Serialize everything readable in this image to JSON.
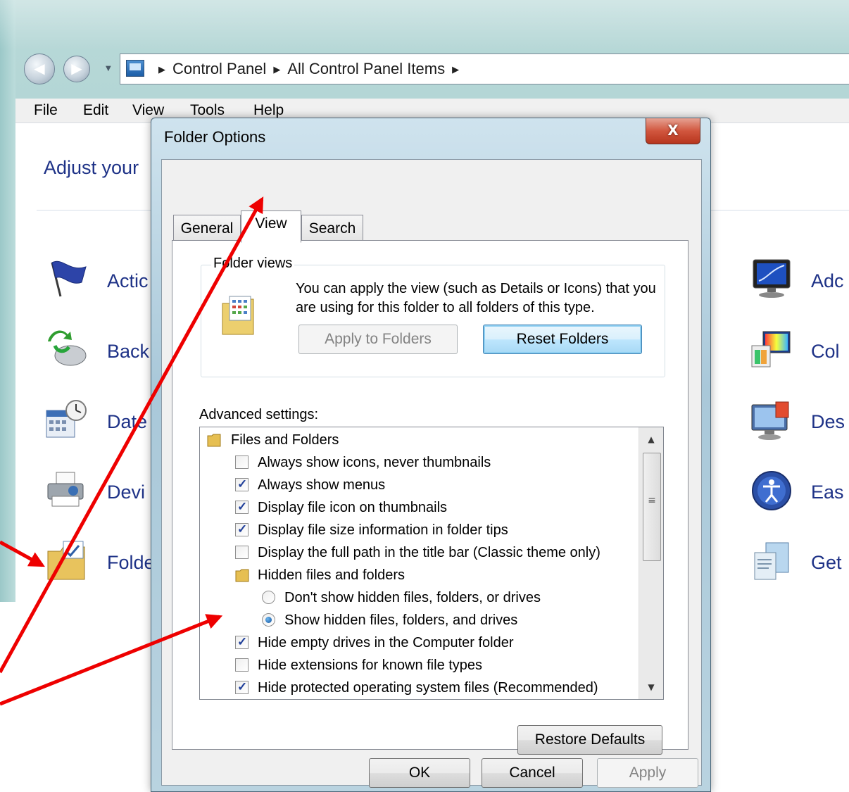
{
  "address_bar": {
    "crumbs": [
      "Control Panel",
      "All Control Panel Items"
    ]
  },
  "menu": [
    "File",
    "Edit",
    "View",
    "Tools",
    "Help"
  ],
  "control_panel": {
    "heading": "Adjust your",
    "items_left": [
      "Actic",
      "Back",
      "Date",
      "Devi",
      "Folde"
    ],
    "items_right": [
      "Adc",
      "Col",
      "Des",
      "Eas",
      "Get"
    ]
  },
  "dialog": {
    "title": "Folder Options",
    "close_label": "X",
    "tabs": [
      "General",
      "View",
      "Search"
    ],
    "folder_views": {
      "label": "Folder views",
      "description": "You can apply the view (such as Details or Icons) that you are using for this folder to all folders of this type.",
      "apply_button": "Apply to Folders",
      "reset_button": "Reset Folders"
    },
    "advanced_label": "Advanced settings:",
    "tree_items": [
      {
        "label": "Files and Folders",
        "type": "folder",
        "level": 0
      },
      {
        "label": "Always show icons, never thumbnails",
        "type": "checkbox",
        "checked": false,
        "level": 1
      },
      {
        "label": "Always show menus",
        "type": "checkbox",
        "checked": true,
        "level": 1
      },
      {
        "label": "Display file icon on thumbnails",
        "type": "checkbox",
        "checked": true,
        "level": 1
      },
      {
        "label": "Display file size information in folder tips",
        "type": "checkbox",
        "checked": true,
        "level": 1
      },
      {
        "label": "Display the full path in the title bar (Classic theme only)",
        "type": "checkbox",
        "checked": false,
        "level": 1
      },
      {
        "label": "Hidden files and folders",
        "type": "folder",
        "level": 1
      },
      {
        "label": "Don't show hidden files, folders, or drives",
        "type": "radio",
        "checked": false,
        "level": 2
      },
      {
        "label": "Show hidden files, folders, and drives",
        "type": "radio",
        "checked": true,
        "level": 2
      },
      {
        "label": "Hide empty drives in the Computer folder",
        "type": "checkbox",
        "checked": true,
        "level": 1
      },
      {
        "label": "Hide extensions for known file types",
        "type": "checkbox",
        "checked": false,
        "level": 1
      },
      {
        "label": "Hide protected operating system files (Recommended)",
        "type": "checkbox",
        "checked": true,
        "level": 1
      }
    ],
    "restore_defaults": "Restore Defaults",
    "ok": "OK",
    "cancel": "Cancel",
    "apply": "Apply"
  },
  "colors": {
    "link_blue": "#1e3287",
    "annotation_red": "#ee0000",
    "close_red": "#c9442b"
  }
}
